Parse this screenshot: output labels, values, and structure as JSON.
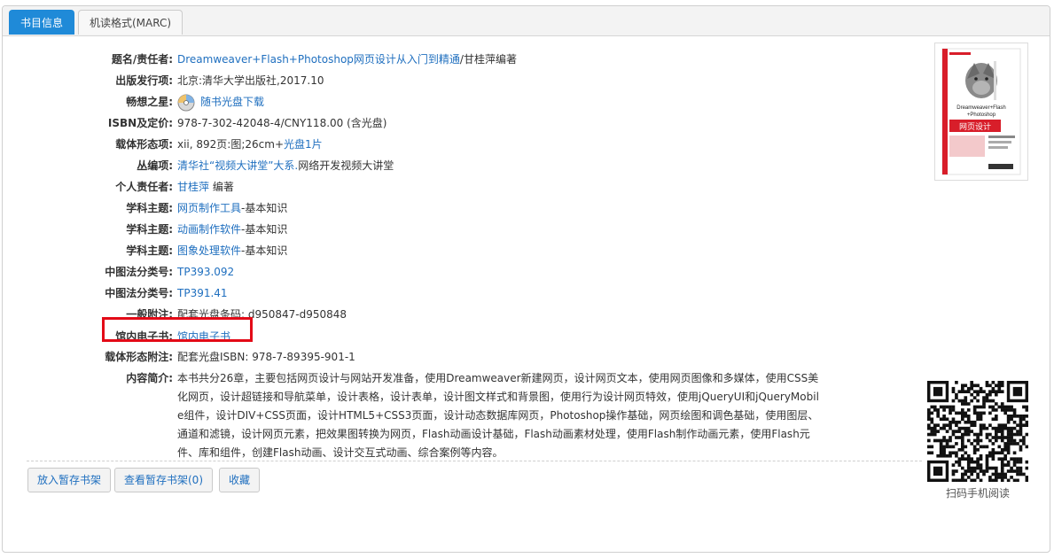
{
  "tabs": [
    {
      "label": "书目信息"
    },
    {
      "label": "机读格式(MARC)"
    }
  ],
  "fields": {
    "title": {
      "label": "题名/责任者:",
      "link": "Dreamweaver+Flash+Photoshop网页设计从入门到精通",
      "text": "/甘桂萍编著"
    },
    "publication": {
      "label": "出版发行项:",
      "text": "北京:清华大学出版社,2017.10"
    },
    "star": {
      "label": "畅想之星:",
      "link": "随书光盘下载"
    },
    "isbn": {
      "label": "ISBN及定价:",
      "text": "978-7-302-42048-4/CNY118.00 (含光盘)"
    },
    "physical": {
      "label": "载体形态项:",
      "text": "xii, 892页:图;26cm+",
      "link": "光盘1片"
    },
    "series": {
      "label": "丛编项:",
      "link": "清华社“视频大讲堂”大系.",
      "text": "网络开发视频大讲堂"
    },
    "author": {
      "label": "个人责任者:",
      "link": "甘桂萍",
      "text": " 编著"
    },
    "subject1": {
      "label": "学科主题:",
      "link": "网页制作工具",
      "text": "-基本知识"
    },
    "subject2": {
      "label": "学科主题:",
      "link": "动画制作软件",
      "text": "-基本知识"
    },
    "subject3": {
      "label": "学科主题:",
      "link": "图象处理软件",
      "text": "-基本知识"
    },
    "clc1": {
      "label": "中图法分类号:",
      "link": "TP393.092"
    },
    "clc2": {
      "label": "中图法分类号:",
      "link": "TP391.41"
    },
    "note": {
      "label": "一般附注:",
      "text": "配套光盘条码: d950847-d950848"
    },
    "ebook": {
      "label": "馆内电子书:",
      "link": "馆内电子书"
    },
    "physnote": {
      "label": "载体形态附注:",
      "text": "配套光盘ISBN: 978-7-89395-901-1"
    },
    "summary": {
      "label": "内容简介:",
      "text": "本书共分26章，主要包括网页设计与网站开发准备，使用Dreamweaver新建网页，设计网页文本，使用网页图像和多媒体，使用CSS美化网页，设计超链接和导航菜单，设计表格，设计表单，设计图文样式和背景图，使用行为设计网页特效，使用jQueryUI和jQueryMobile组件，设计DIV+CSS页面，设计HTML5+CSS3页面，设计动态数据库网页，Photoshop操作基础，网页绘图和调色基础，使用图层、通道和滤镜，设计网页元素，把效果图转换为网页，Flash动画设计基础，Flash动画素材处理，使用Flash制作动画元素，使用Flash元件、库和组件，创建Flash动画、设计交互式动画、综合案例等内容。"
    }
  },
  "buttons": {
    "add_shelf": "放入暂存书架",
    "view_shelf": "查看暂存书架(0)",
    "favorite": "收藏"
  },
  "cover": {
    "line1": "Dreamweaver+Flash",
    "line2": "+Photoshop",
    "line3": "网页设计"
  },
  "qr_caption": "扫码手机阅读",
  "colors": {
    "accent": "#1f8ad8",
    "link": "#1f6fbf",
    "highlight": "#e30a17",
    "cover_red": "#d81e2a"
  }
}
